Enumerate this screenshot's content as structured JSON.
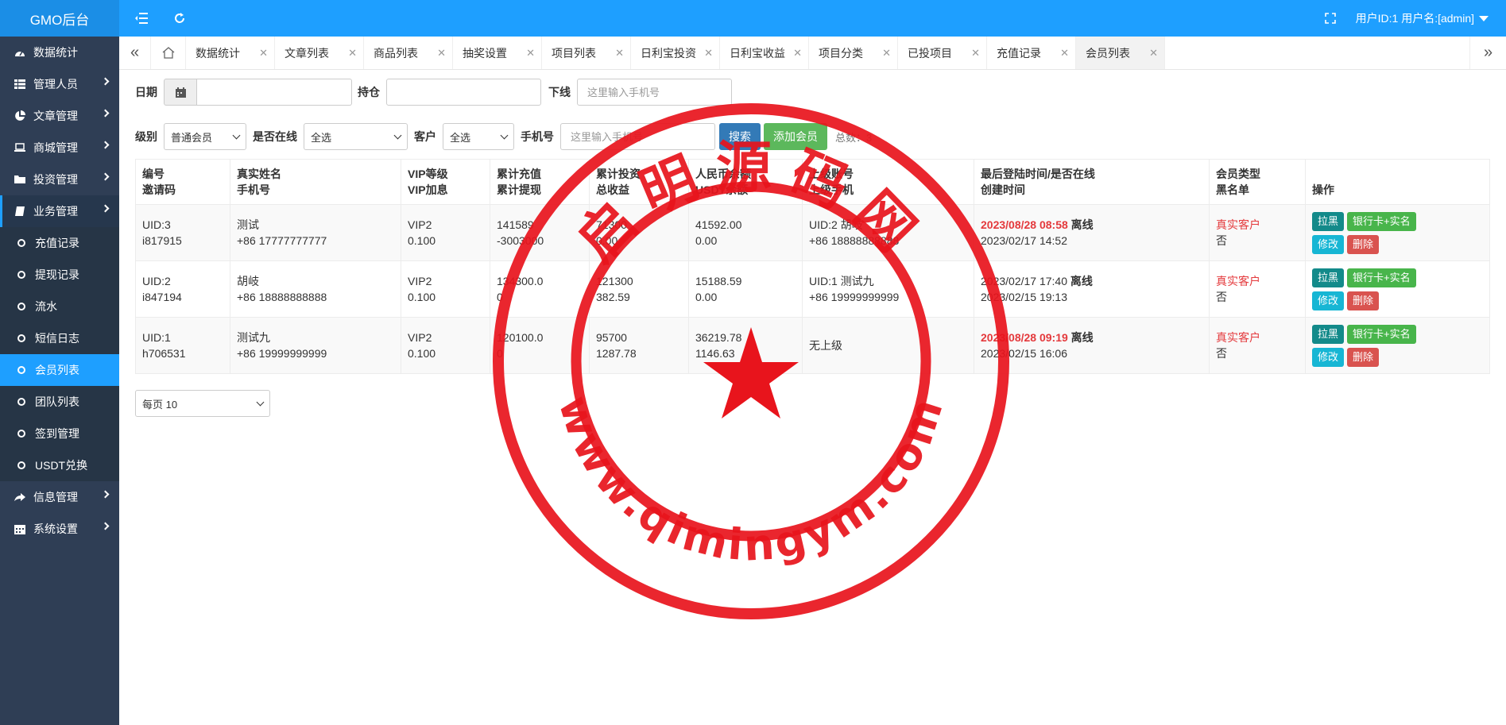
{
  "header": {
    "logo": "GMO后台",
    "user_info": "用户ID:1 用户名:[admin]"
  },
  "sidebar": {
    "items": [
      {
        "label": "数据统计",
        "icon": "dashboard-icon"
      },
      {
        "label": "管理人员",
        "icon": "table-icon"
      },
      {
        "label": "文章管理",
        "icon": "pie-chart-icon"
      },
      {
        "label": "商城管理",
        "icon": "laptop-icon"
      },
      {
        "label": "投资管理",
        "icon": "folder-icon"
      },
      {
        "label": "业务管理",
        "icon": "book-icon"
      }
    ],
    "sub_items": [
      "充值记录",
      "提现记录",
      "流水",
      "短信日志",
      "会员列表",
      "团队列表",
      "签到管理",
      "USDT兑换"
    ],
    "bottom_items": [
      {
        "label": "信息管理",
        "icon": "share-icon"
      },
      {
        "label": "系统设置",
        "icon": "calendar-icon"
      }
    ]
  },
  "tabs": [
    "数据统计",
    "文章列表",
    "商品列表",
    "抽奖设置",
    "项目列表",
    "日利宝投资",
    "日利宝收益",
    "项目分类",
    "已投项目",
    "充值记录",
    "会员列表"
  ],
  "active_tab": "会员列表",
  "filters": {
    "date_label": "日期",
    "hold_label": "持仓",
    "downline_label": "下线",
    "downline_placeholder": "这里输入手机号",
    "level_label": "级别",
    "level_value": "普通会员",
    "online_label": "是否在线",
    "online_value": "全选",
    "customer_label": "客户",
    "customer_value": "全选",
    "phone_label": "手机号",
    "phone_placeholder": "这里输入手机号",
    "search_button": "搜索",
    "add_button": "添加会员",
    "total_text": "总数：3"
  },
  "table": {
    "headers": [
      [
        "编号",
        "邀请码"
      ],
      [
        "真实姓名",
        "手机号"
      ],
      [
        "VIP等级",
        "VIP加息"
      ],
      [
        "累计充值",
        "累计提现"
      ],
      [
        "累计投资",
        "总收益"
      ],
      [
        "人民币余额",
        "USDT余额"
      ],
      [
        "上级账号",
        "上级手机"
      ],
      [
        "最后登陆时间/是否在线",
        "创建时间"
      ],
      [
        "会员类型",
        "黑名单"
      ],
      [
        "",
        "操作"
      ]
    ],
    "rows": [
      {
        "uid": "UID:3",
        "code": "i817915",
        "name": "测试",
        "phone": "+86 17777777777",
        "vip": "VIP2",
        "vip_rate": "0.100",
        "recharge": "141589",
        "withdraw": "-3003000",
        "invest": "71300",
        "profit": "0.00",
        "rmb": "41592.00",
        "usdt": "0.00",
        "parent": "UID:2 胡岐",
        "parent_phone": "+86 18888888888",
        "last_login": "2023/08/28 08:58",
        "last_login_red": true,
        "online": "离线",
        "created": "2023/02/17 14:52",
        "type": "真实客户",
        "blacklist": "否"
      },
      {
        "uid": "UID:2",
        "code": "i847194",
        "name": "胡岐",
        "phone": "+86 18888888888",
        "vip": "VIP2",
        "vip_rate": "0.100",
        "recharge": "134300.0",
        "withdraw": "0",
        "invest": "121300",
        "profit": "382.59",
        "rmb": "15188.59",
        "usdt": "0.00",
        "parent": "UID:1 测试九",
        "parent_phone": "+86 19999999999",
        "last_login": "2023/02/17 17:40",
        "last_login_red": false,
        "online": "离线",
        "created": "2023/02/15 19:13",
        "type": "真实客户",
        "blacklist": "否"
      },
      {
        "uid": "UID:1",
        "code": "h706531",
        "name": "测试九",
        "phone": "+86 19999999999",
        "vip": "VIP2",
        "vip_rate": "0.100",
        "recharge": "120100.0",
        "withdraw": "0",
        "invest": "95700",
        "profit": "1287.78",
        "rmb": "36219.78",
        "usdt": "1146.63",
        "parent": "无上级",
        "parent_phone": "",
        "last_login": "2023/08/28 09:19",
        "last_login_red": true,
        "online": "离线",
        "created": "2023/02/15 16:06",
        "type": "真实客户",
        "blacklist": "否"
      }
    ],
    "op_buttons": [
      "拉黑",
      "银行卡+实名",
      "修改",
      "删除"
    ]
  },
  "pager": {
    "per_page": "每页 10"
  },
  "watermark": {
    "title": "启明源码网",
    "url": "www.qimingym.com",
    "color": "#e8141c"
  }
}
